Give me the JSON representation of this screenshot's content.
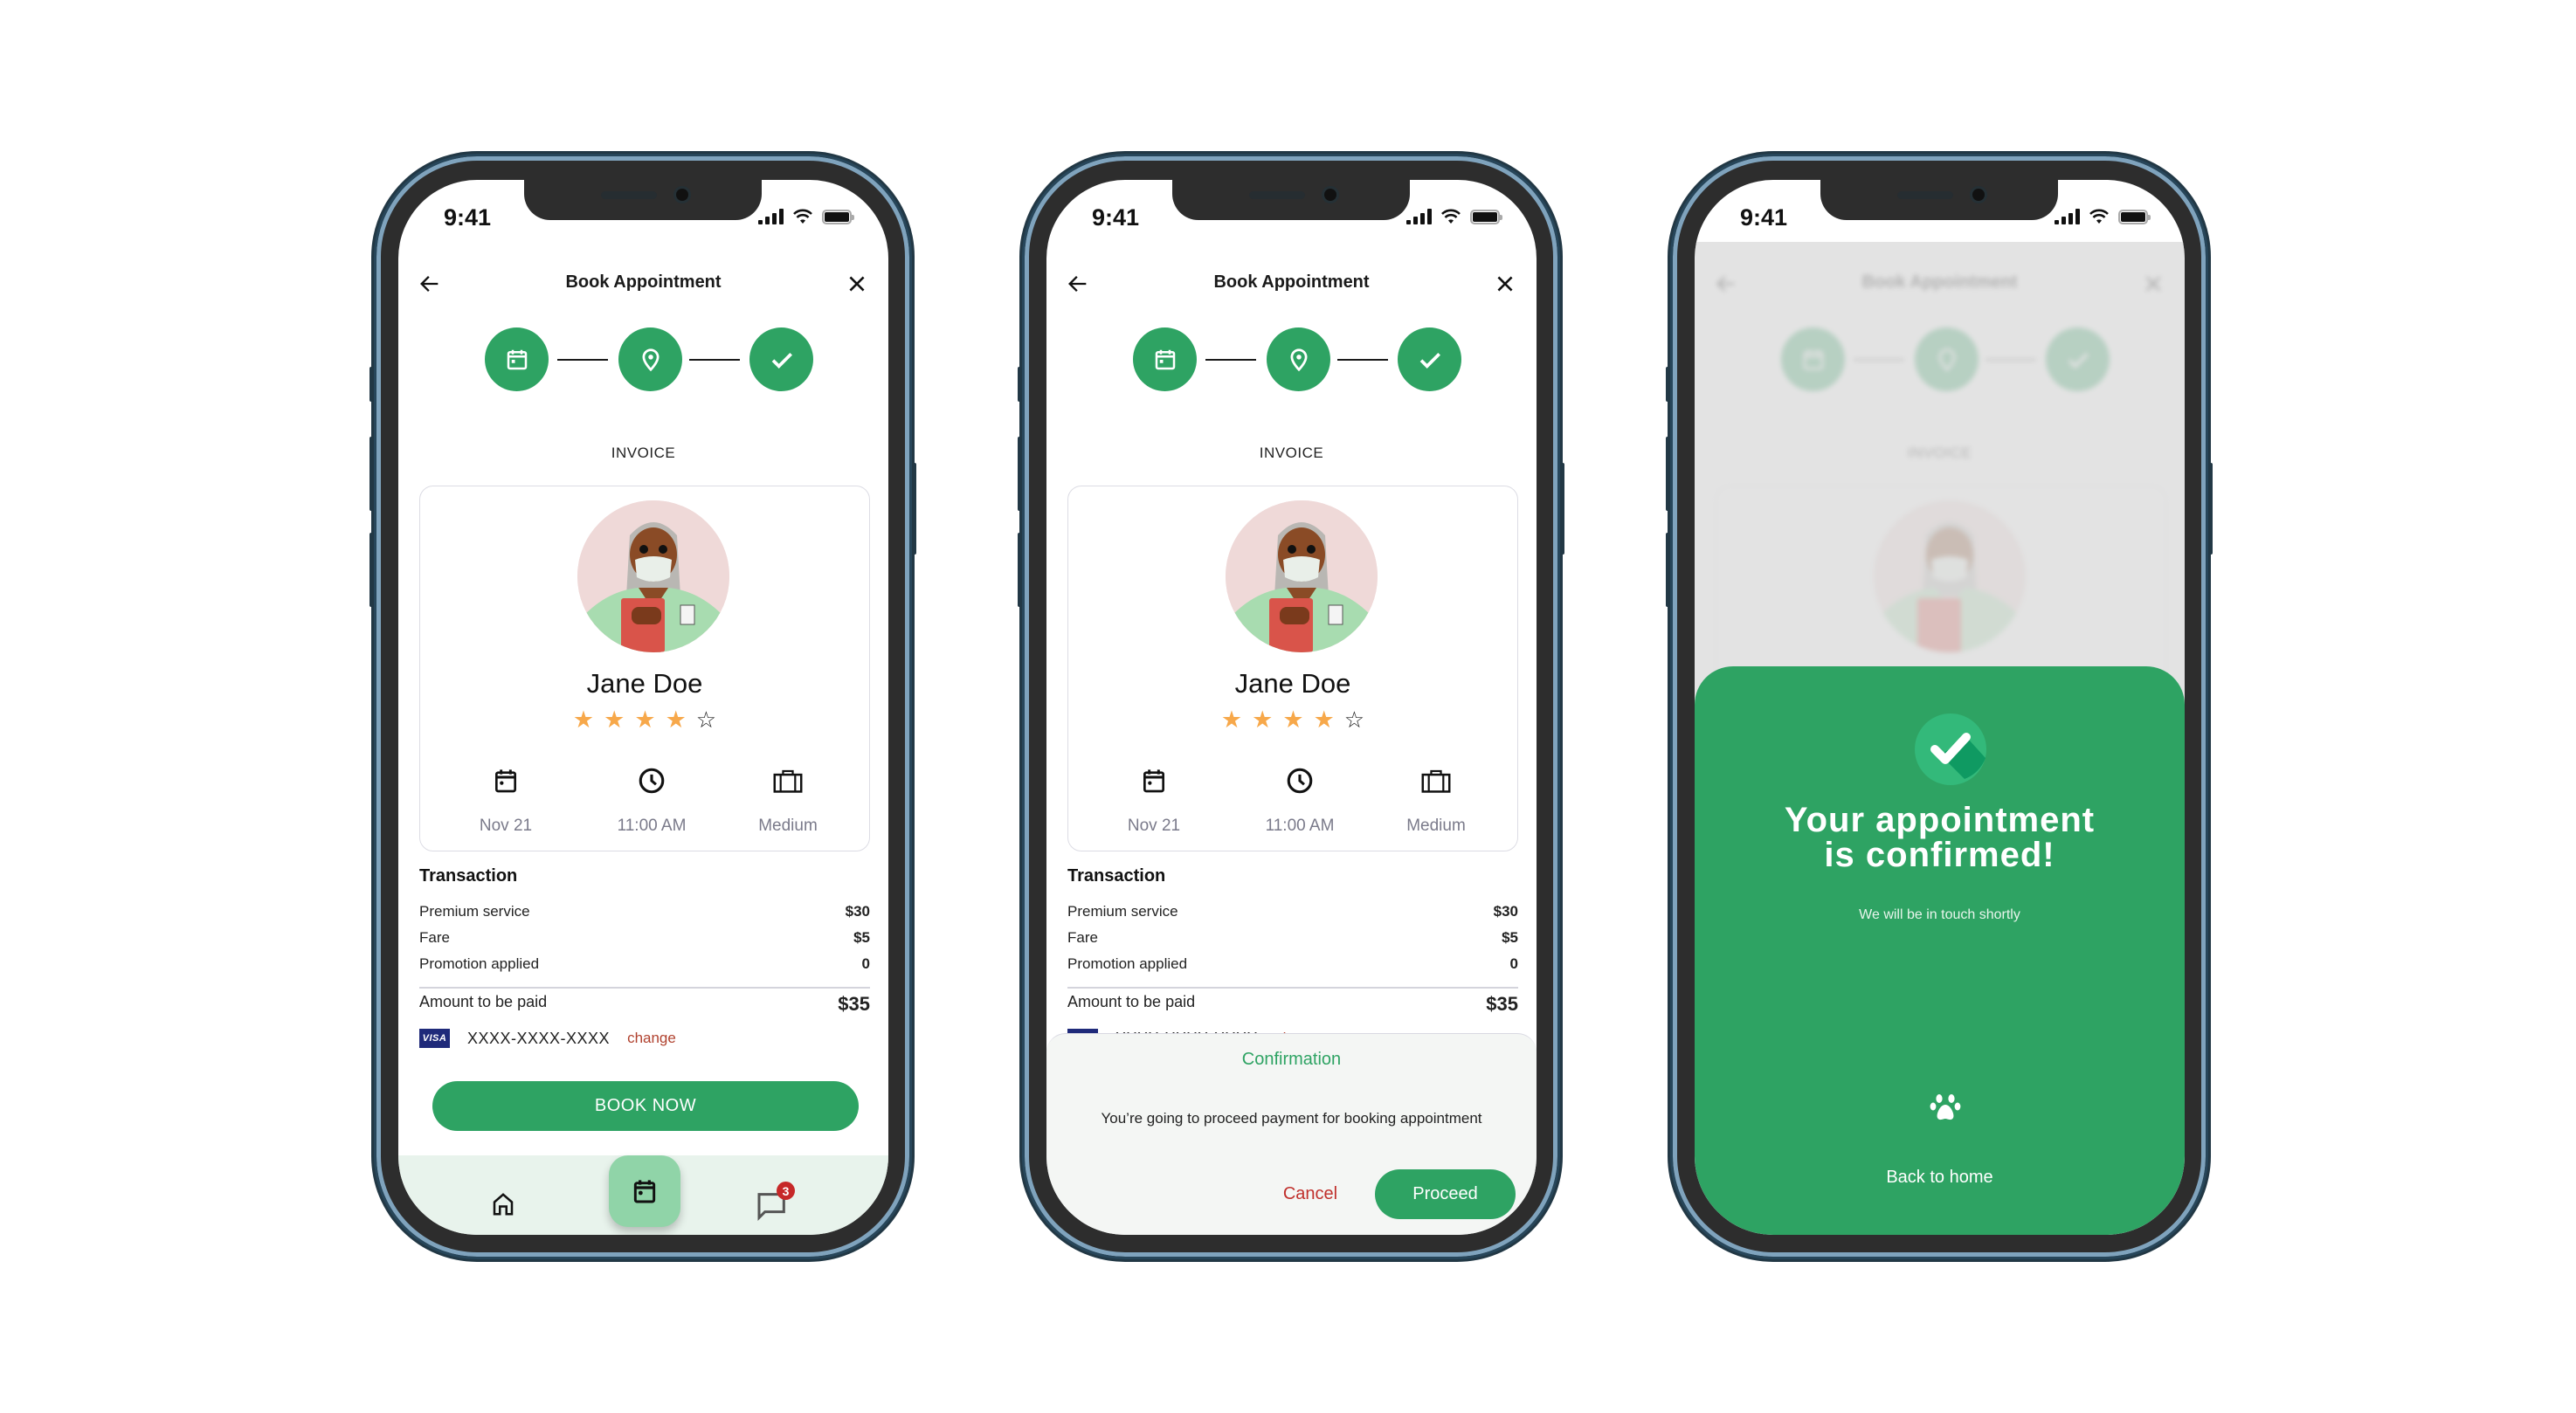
{
  "phones": [
    {
      "id": "invoice-screen",
      "status": {
        "time": "9:41"
      },
      "header": {
        "title": "Book Appointment",
        "back_icon": "arrow-left-icon",
        "close_icon": "close-icon"
      },
      "stepper": [
        {
          "icon": "calendar-icon",
          "state": "completed"
        },
        {
          "icon": "location-pin-icon",
          "state": "completed"
        },
        {
          "icon": "check-icon",
          "state": "completed"
        }
      ],
      "invoice_label": "INVOICE",
      "doctor": {
        "name": "Jane Doe",
        "rating": 4,
        "rating_max": 5,
        "info": [
          {
            "icon": "calendar-icon",
            "label": "Nov 21"
          },
          {
            "icon": "clock-icon",
            "label": "11:00 AM"
          },
          {
            "icon": "briefcase-icon",
            "label": "Medium"
          }
        ]
      },
      "transaction": {
        "title": "Transaction",
        "rows": [
          {
            "label": "Premium service",
            "value": "$30"
          },
          {
            "label": "Fare",
            "value": "$5"
          },
          {
            "label": "Promotion applied",
            "value": "0"
          }
        ],
        "total": {
          "label": "Amount to be paid",
          "value": "$35"
        },
        "payment": {
          "brand": "VISA",
          "card": "XXXX-XXXX-XXXX",
          "change_label": "change"
        }
      },
      "book_button": "BOOK NOW",
      "bottom_nav": {
        "items": [
          {
            "icon": "home-icon"
          },
          {
            "icon": "calendar-icon",
            "active": true
          },
          {
            "icon": "message-icon",
            "badge": "3"
          }
        ]
      }
    },
    {
      "id": "confirmation-dialog-screen",
      "status": {
        "time": "9:41"
      },
      "header": {
        "title": "Book Appointment"
      },
      "invoice_label": "INVOICE",
      "doctor": {
        "name": "Jane Doe",
        "rating": 4,
        "info": [
          {
            "label": "Nov 21"
          },
          {
            "label": "11:00 AM"
          },
          {
            "label": "Medium"
          }
        ]
      },
      "transaction": {
        "title": "Transaction",
        "rows": [
          {
            "label": "Premium service",
            "value": "$30"
          },
          {
            "label": "Fare",
            "value": "$5"
          },
          {
            "label": "Promotion applied",
            "value": "0"
          }
        ],
        "total": {
          "label": "Amount to be paid",
          "value": "$35"
        },
        "payment": {
          "brand": "VISA",
          "card": "XXXX-XXXX-XXXX",
          "change_label": "change"
        }
      },
      "dialog": {
        "title": "Confirmation",
        "message": "You’re going to proceed payment for booking appointment",
        "cancel_label": "Cancel",
        "proceed_label": "Proceed"
      }
    },
    {
      "id": "success-screen",
      "status": {
        "time": "9:41"
      },
      "header": {
        "title": "Book Appointment"
      },
      "invoice_label": "INVOICE",
      "success": {
        "icon": "check-circle-icon",
        "title_line1": "Your appointment",
        "title_line2": "is confirmed!",
        "subtitle": "We will be in touch shortly",
        "footer_icon": "paw-icon",
        "back_label": "Back to home"
      }
    }
  ],
  "colors": {
    "primary_green": "#2ea363",
    "fab_green": "#90d4a8",
    "nav_bg": "#e8f3ec",
    "star": "#f7a84a",
    "danger": "#c0302c",
    "change_link": "#b0412e",
    "visa_blue": "#1f2a7a"
  }
}
